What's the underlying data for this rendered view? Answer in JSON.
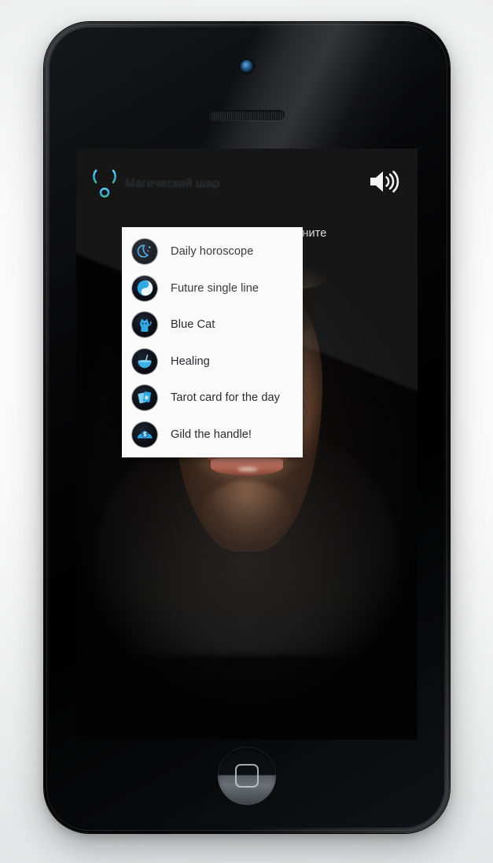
{
  "app": {
    "logo_icon": "uranus-astrology-symbol",
    "title": "Магический шар",
    "volume_icon": "speaker-volume-icon",
    "instruction": "Задумайте вопрос и кликните",
    "accent_color": "#2aa8e0",
    "menu_bg_color": "#fafafa",
    "menu_text_color": "#27282b"
  },
  "menu": {
    "items": [
      {
        "label": "Daily horoscope",
        "icon": "crescent-moon-stars-icon"
      },
      {
        "label": "Future single line",
        "icon": "yin-yang-icon"
      },
      {
        "label": "Blue Cat",
        "icon": "blue-cat-icon"
      },
      {
        "label": "Healing",
        "icon": "potion-bowl-icon"
      },
      {
        "label": "Tarot card for the day",
        "icon": "tarot-cards-icon"
      },
      {
        "label": "Gild the handle!",
        "icon": "palm-with-coin-icon"
      }
    ]
  },
  "device": {
    "camera": "front-camera",
    "earpiece": "earpiece-speaker",
    "home_button": "home-button"
  }
}
